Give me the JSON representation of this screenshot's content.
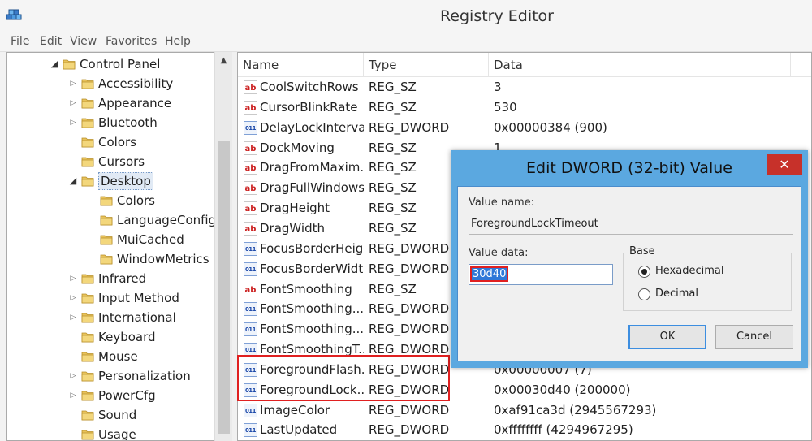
{
  "window": {
    "title": "Registry Editor"
  },
  "menu": [
    "File",
    "Edit",
    "View",
    "Favorites",
    "Help"
  ],
  "tree": [
    {
      "label": "Control Panel",
      "level": 0,
      "expanded": true
    },
    {
      "label": "Accessibility",
      "level": 1,
      "expandable": true
    },
    {
      "label": "Appearance",
      "level": 1,
      "expandable": true
    },
    {
      "label": "Bluetooth",
      "level": 1,
      "expandable": true
    },
    {
      "label": "Colors",
      "level": 1,
      "expandable": false
    },
    {
      "label": "Cursors",
      "level": 1,
      "expandable": false
    },
    {
      "label": "Desktop",
      "level": 1,
      "expanded": true,
      "selected": true
    },
    {
      "label": "Colors",
      "level": 2,
      "expandable": false
    },
    {
      "label": "LanguageConfig",
      "level": 2,
      "expandable": false
    },
    {
      "label": "MuiCached",
      "level": 2,
      "expandable": false
    },
    {
      "label": "WindowMetrics",
      "level": 2,
      "expandable": false
    },
    {
      "label": "Infrared",
      "level": 1,
      "expandable": true
    },
    {
      "label": "Input Method",
      "level": 1,
      "expandable": true
    },
    {
      "label": "International",
      "level": 1,
      "expandable": true
    },
    {
      "label": "Keyboard",
      "level": 1,
      "expandable": false
    },
    {
      "label": "Mouse",
      "level": 1,
      "expandable": false
    },
    {
      "label": "Personalization",
      "level": 1,
      "expandable": true
    },
    {
      "label": "PowerCfg",
      "level": 1,
      "expandable": true
    },
    {
      "label": "Sound",
      "level": 1,
      "expandable": false
    },
    {
      "label": "Usage",
      "level": 1,
      "expandable": false
    }
  ],
  "list": {
    "columns": [
      "Name",
      "Type",
      "Data"
    ],
    "rows": [
      {
        "name": "CoolSwitchRows",
        "type": "REG_SZ",
        "data": "3",
        "icon": "string-value-icon"
      },
      {
        "name": "CursorBlinkRate",
        "type": "REG_SZ",
        "data": "530",
        "icon": "string-value-icon"
      },
      {
        "name": "DelayLockInterval",
        "type": "REG_DWORD",
        "data": "0x00000384 (900)",
        "icon": "binary-value-icon"
      },
      {
        "name": "DockMoving",
        "type": "REG_SZ",
        "data": "1",
        "icon": "string-value-icon"
      },
      {
        "name": "DragFromMaxim...",
        "type": "REG_SZ",
        "data": "",
        "icon": "string-value-icon"
      },
      {
        "name": "DragFullWindows",
        "type": "REG_SZ",
        "data": "",
        "icon": "string-value-icon"
      },
      {
        "name": "DragHeight",
        "type": "REG_SZ",
        "data": "",
        "icon": "string-value-icon"
      },
      {
        "name": "DragWidth",
        "type": "REG_SZ",
        "data": "",
        "icon": "string-value-icon"
      },
      {
        "name": "FocusBorderHeig...",
        "type": "REG_DWORD",
        "data": "",
        "icon": "binary-value-icon"
      },
      {
        "name": "FocusBorderWidth",
        "type": "REG_DWORD",
        "data": "",
        "icon": "binary-value-icon"
      },
      {
        "name": "FontSmoothing",
        "type": "REG_SZ",
        "data": "",
        "icon": "string-value-icon"
      },
      {
        "name": "FontSmoothing...",
        "type": "REG_DWORD",
        "data": "",
        "icon": "binary-value-icon"
      },
      {
        "name": "FontSmoothing...",
        "type": "REG_DWORD",
        "data": "",
        "icon": "binary-value-icon"
      },
      {
        "name": "FontSmoothingT...",
        "type": "REG_DWORD",
        "data": "",
        "icon": "binary-value-icon"
      },
      {
        "name": "ForegroundFlash...",
        "type": "REG_DWORD",
        "data": "0x00000007 (7)",
        "icon": "binary-value-icon"
      },
      {
        "name": "ForegroundLock...",
        "type": "REG_DWORD",
        "data": "0x00030d40 (200000)",
        "icon": "binary-value-icon"
      },
      {
        "name": "ImageColor",
        "type": "REG_DWORD",
        "data": "0xaf91ca3d (2945567293)",
        "icon": "binary-value-icon"
      },
      {
        "name": "LastUpdated",
        "type": "REG_DWORD",
        "data": "0xffffffff (4294967295)",
        "icon": "binary-value-icon"
      }
    ]
  },
  "dialog": {
    "title": "Edit DWORD (32-bit) Value",
    "close_glyph": "✕",
    "value_name_label": "Value name:",
    "value_name": "ForegroundLockTimeout",
    "value_data_label": "Value data:",
    "value_data": "30d40",
    "base_label": "Base",
    "hex_label": "Hexadecimal",
    "dec_label": "Decimal",
    "hex_selected": true,
    "ok_label": "OK",
    "cancel_label": "Cancel"
  },
  "colors": {
    "dialog_frame": "#5ba8e0",
    "close_button": "#c7312a",
    "highlight": "#e02020",
    "selection": "#2f78d8"
  }
}
